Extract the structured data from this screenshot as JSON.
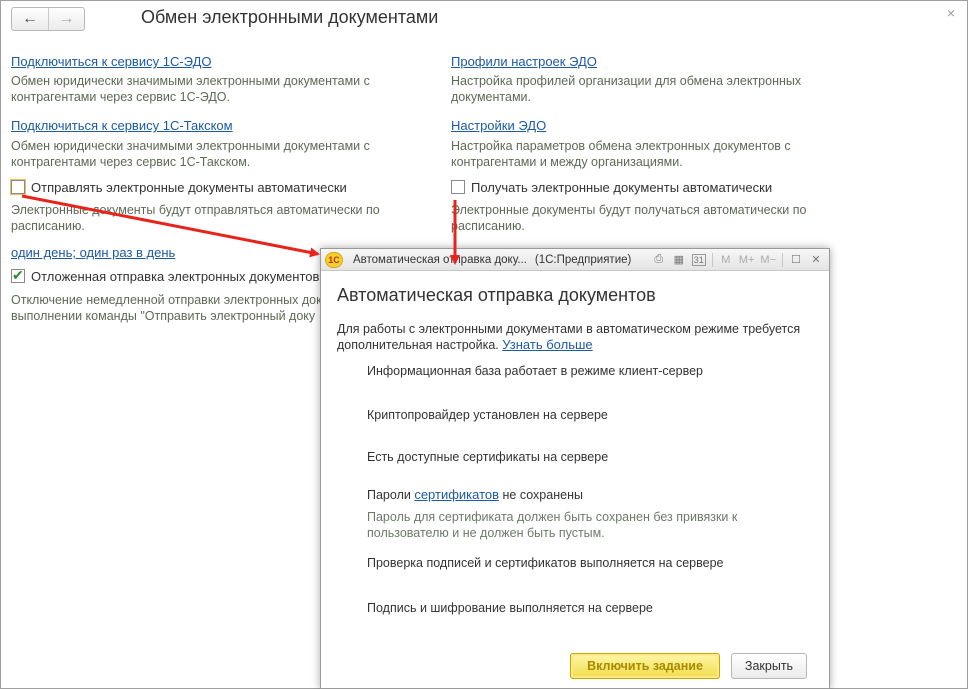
{
  "header": {
    "title": "Обмен электронными документами",
    "back_icon": "←",
    "forward_icon": "→",
    "close_icon": "×"
  },
  "left": {
    "link1": "Подключиться к сервису 1С-ЭДО",
    "desc1": "Обмен юридически значимыми электронными документами с контрагентами через сервис 1С-ЭДО.",
    "link2": "Подключиться к сервису 1С-Такском",
    "desc2": "Обмен юридически значимыми электронными документами с контрагентами через сервис 1С-Такском.",
    "send_auto_label": "Отправлять электронные документы автоматически",
    "send_auto_desc": "Электронные документы будут отправляться автоматически по расписанию.",
    "schedule_link": "один день; один раз в день",
    "deferred_label": "Отложенная отправка электронных документов",
    "deferred_desc_1": "Отключение немедленной отправки электронных документов",
    "deferred_desc_2": "выполнении команды \"Отправить электронный доку"
  },
  "right": {
    "link1": "Профили настроек ЭДО",
    "desc1": "Настройка профилей организации для обмена электронных документами.",
    "link2": "Настройки ЭДО",
    "desc2": "Настройка параметров обмена электронных документов с контрагентами и между организациями.",
    "recv_auto_label": "Получать электронные документы автоматически",
    "recv_auto_desc": "Электронные документы будут получаться автоматически по расписанию."
  },
  "dialog": {
    "window_title": "Автоматическая отправка доку...",
    "window_suffix": "(1С:Предприятие)",
    "logo_text": "1С",
    "toolbar_icons": [
      "print-icon",
      "calculator-icon",
      "calendar-icon",
      "memory-m-icon",
      "memory-plus-icon",
      "memory-minus-icon",
      "maximize-icon",
      "close-icon"
    ],
    "toolbar_glyphs": {
      "print": "⎙",
      "calc": "▦",
      "calendar": "31",
      "m": "M",
      "mplus": "M+",
      "mminus": "M−",
      "max": "☐",
      "close": "✕"
    },
    "heading": "Автоматическая отправка документов",
    "intro": "Для работы с электронными документами в автоматическом режиме требуется дополнительная настройка.",
    "learn_more": "Узнать больше",
    "req1": "Информационная база работает в режиме клиент-сервер",
    "req2": "Криптопровайдер установлен на сервере",
    "req3": "Есть доступные сертификаты на сервере",
    "req4_prefix": "Пароли",
    "req4_link": "сертификатов",
    "req4_suffix": "не сохранены",
    "req4_desc": "Пароль для сертификата должен быть сохранен без привязки к пользователю и не должен быть пустым.",
    "req5": "Проверка подписей и сертификатов выполняется на сервере",
    "req6": "Подпись и шифрование выполняется на сервере",
    "enable_button": "Включить задание",
    "close_button": "Закрыть"
  },
  "colors": {
    "link": "#1c5aa5",
    "annotation_arrow": "#e8231c",
    "primary_button": "#f1dc4a"
  }
}
